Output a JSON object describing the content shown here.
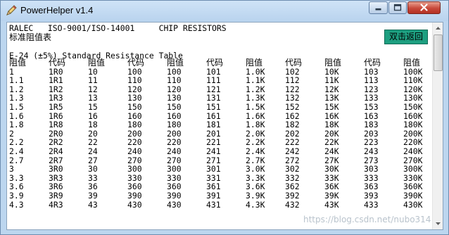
{
  "window": {
    "title": "PowerHelper v1.4"
  },
  "header": {
    "line1": "RALEC   ISO-9001/ISO-14001     CHIP RESISTORS",
    "line2": "标准阻值表",
    "back_button": "双击返回",
    "table_title": "E-24 (±5%) Standard Resistance Table"
  },
  "table": {
    "headers": [
      "阻值",
      "代码",
      "阻值",
      "代码",
      "阻值",
      "代码",
      "阻值",
      "代码",
      "阻值",
      "代码",
      "阻值"
    ],
    "rows": [
      [
        "1",
        "1R0",
        "10",
        "100",
        "100",
        "101",
        "1.0K",
        "102",
        "10K",
        "103",
        "100K"
      ],
      [
        "1.1",
        "1R1",
        "11",
        "110",
        "110",
        "111",
        "1.1K",
        "112",
        "11K",
        "113",
        "110K"
      ],
      [
        "1.2",
        "1R2",
        "12",
        "120",
        "120",
        "121",
        "1.2K",
        "122",
        "12K",
        "123",
        "120K"
      ],
      [
        "1.3",
        "1R3",
        "13",
        "130",
        "130",
        "131",
        "1.3K",
        "132",
        "13K",
        "133",
        "130K"
      ],
      [
        "1.5",
        "1R5",
        "15",
        "150",
        "150",
        "151",
        "1.5K",
        "152",
        "15K",
        "153",
        "150K"
      ],
      [
        "1.6",
        "1R6",
        "16",
        "160",
        "160",
        "161",
        "1.6K",
        "162",
        "16K",
        "163",
        "160K"
      ],
      [
        "1.8",
        "1R8",
        "18",
        "180",
        "180",
        "181",
        "1.8K",
        "182",
        "18K",
        "183",
        "180K"
      ],
      [
        "2",
        "2R0",
        "20",
        "200",
        "200",
        "201",
        "2.0K",
        "202",
        "20K",
        "203",
        "200K"
      ],
      [
        "2.2",
        "2R2",
        "22",
        "220",
        "220",
        "221",
        "2.2K",
        "222",
        "22K",
        "223",
        "220K"
      ],
      [
        "2.4",
        "2R4",
        "24",
        "240",
        "240",
        "241",
        "2.4K",
        "242",
        "24K",
        "243",
        "240K"
      ],
      [
        "2.7",
        "2R7",
        "27",
        "270",
        "270",
        "271",
        "2.7K",
        "272",
        "27K",
        "273",
        "270K"
      ],
      [
        "3",
        "3R0",
        "30",
        "300",
        "300",
        "301",
        "3.0K",
        "302",
        "30K",
        "303",
        "300K"
      ],
      [
        "3.3",
        "3R3",
        "33",
        "330",
        "330",
        "331",
        "3.3K",
        "332",
        "33K",
        "333",
        "330K"
      ],
      [
        "3.6",
        "3R6",
        "36",
        "360",
        "360",
        "361",
        "3.6K",
        "362",
        "36K",
        "363",
        "360K"
      ],
      [
        "3.9",
        "3R9",
        "39",
        "390",
        "390",
        "391",
        "3.9K",
        "392",
        "39K",
        "393",
        "390K"
      ],
      [
        "4.3",
        "4R3",
        "43",
        "430",
        "430",
        "431",
        "4.3K",
        "432",
        "43K",
        "433",
        "430K"
      ]
    ]
  },
  "watermark": "https://blog.csdn.net/nubo314",
  "colors": {
    "titlebar": "#bcd6ef",
    "back_button": "#1d9f80",
    "close_button": "#c8483a"
  },
  "icons": {
    "app": "pencil-icon",
    "minimize": "minimize-icon",
    "maximize": "maximize-icon",
    "close": "close-icon"
  }
}
